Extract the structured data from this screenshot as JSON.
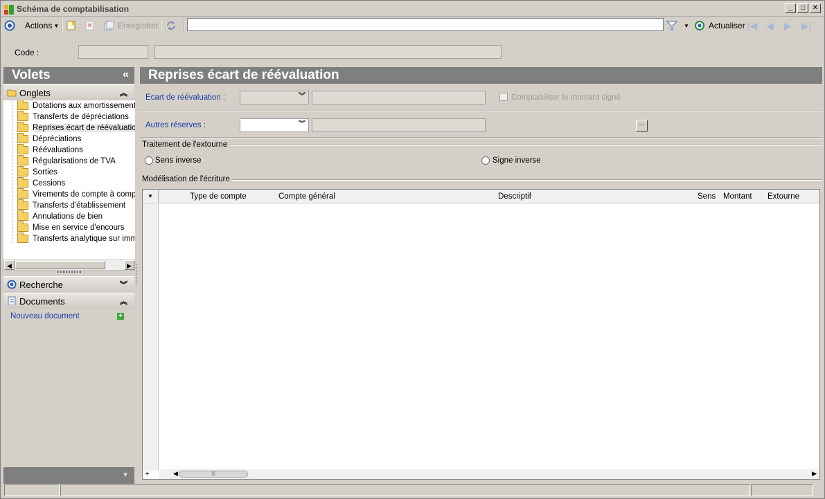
{
  "window": {
    "title": "Schéma de comptabilisation"
  },
  "toolbar": {
    "actions_label": "Actions",
    "save_label": "Enregistrer",
    "search_value": "",
    "refresh_label": "Actualiser"
  },
  "header": {
    "code_label": "Code :"
  },
  "sidebar": {
    "title": "Volets",
    "onglets_label": "Onglets",
    "items": [
      {
        "label": "Dotations aux amortissements",
        "selected": false
      },
      {
        "label": "Transferts de dépréciations",
        "selected": false
      },
      {
        "label": "Reprises écart de réévaluation",
        "selected": true
      },
      {
        "label": "Dépréciations",
        "selected": false
      },
      {
        "label": "Réévaluations",
        "selected": false
      },
      {
        "label": "Régularisations de TVA",
        "selected": false
      },
      {
        "label": "Sorties",
        "selected": false
      },
      {
        "label": "Cessions",
        "selected": false
      },
      {
        "label": "Virements de compte à compte",
        "selected": false
      },
      {
        "label": "Transferts d'établissement",
        "selected": false
      },
      {
        "label": "Annulations de bien",
        "selected": false
      },
      {
        "label": "Mise en service d'encours",
        "selected": false
      },
      {
        "label": "Transferts analytique sur immo",
        "selected": false
      }
    ],
    "recherche_label": "Recherche",
    "documents_label": "Documents",
    "new_document_label": "Nouveau document"
  },
  "main": {
    "title": "Reprises écart de réévaluation",
    "ecart_label": "Ecart de réévaluation :",
    "comptabiliser_label": "Comptabiliser le montant signé",
    "autres_label": "Autres réserves :",
    "ellipsis_label": "...",
    "traitement_title": "Traitement de l'extourne",
    "radio_sens_inverse": "Sens inverse",
    "radio_signe_inverse": "Signe inverse",
    "modelisation_title": "Modélisation de l'écriture",
    "grid_columns": [
      "Type de compte",
      "Compte général",
      "Descriptif",
      "Sens",
      "Montant",
      "Extourne"
    ]
  },
  "colors": {
    "header_bg": "#7f7f7f",
    "link_blue": "#1a3aa8",
    "window_bg": "#d4d0c8"
  }
}
